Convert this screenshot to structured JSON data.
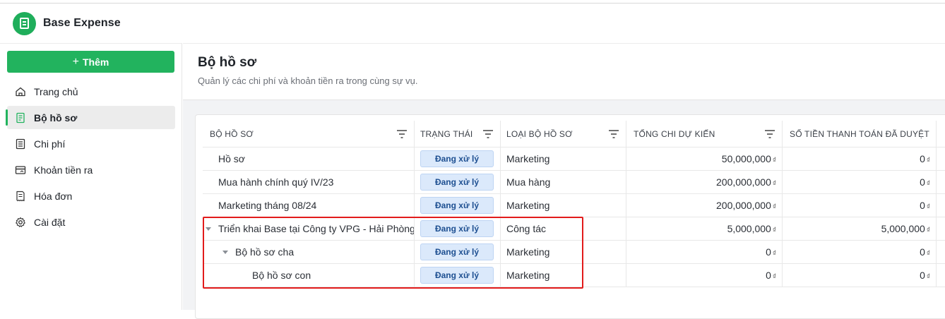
{
  "app": {
    "title": "Base Expense"
  },
  "sidebar": {
    "add_label": "Thêm",
    "items": [
      {
        "label": "Trang chủ",
        "icon": "home-icon",
        "active": false
      },
      {
        "label": "Bộ hồ sơ",
        "icon": "document-icon",
        "active": true
      },
      {
        "label": "Chi phí",
        "icon": "list-icon",
        "active": false
      },
      {
        "label": "Khoản tiền ra",
        "icon": "card-icon",
        "active": false
      },
      {
        "label": "Hóa đơn",
        "icon": "receipt-icon",
        "active": false
      },
      {
        "label": "Cài đặt",
        "icon": "gear-icon",
        "active": false
      }
    ]
  },
  "page": {
    "title": "Bộ hồ sơ",
    "subtitle": "Quản lý các chi phí và khoản tiền ra trong cùng sự vụ."
  },
  "table": {
    "columns": [
      "BỘ HỒ SƠ",
      "TRẠNG THÁI",
      "LOẠI BỘ HỒ SƠ",
      "TỔNG CHI DỰ KIẾN",
      "SỐ TIỀN THANH TOÁN ĐÃ DUYỆT"
    ],
    "currency": "₫",
    "rows": [
      {
        "name": "Hồ sơ",
        "status": "Đang xử lý",
        "type": "Marketing",
        "total": "50,000,000",
        "paid": "0"
      },
      {
        "name": "Mua hành chính quý IV/23",
        "status": "Đang xử lý",
        "type": "Mua hàng",
        "total": "200,000,000",
        "paid": "0"
      },
      {
        "name": "Marketing tháng 08/24",
        "status": "Đang xử lý",
        "type": "Marketing",
        "total": "200,000,000",
        "paid": "0"
      },
      {
        "name": "Triển khai Base tại Công ty VPG - Hải Phòng",
        "status": "Đang xử lý",
        "type": "Công tác",
        "total": "5,000,000",
        "paid": "5,000,000"
      },
      {
        "name": "Bộ hồ sơ cha",
        "status": "Đang xử lý",
        "type": "Marketing",
        "total": "0",
        "paid": "0"
      },
      {
        "name": "Bộ hồ sơ con",
        "status": "Đang xử lý",
        "type": "Marketing",
        "total": "0",
        "paid": "0"
      }
    ]
  },
  "colors": {
    "accent": "#22b35e",
    "badge_bg": "#dbe9fb",
    "badge_text": "#1d4f91",
    "highlight": "#e21b1b"
  }
}
